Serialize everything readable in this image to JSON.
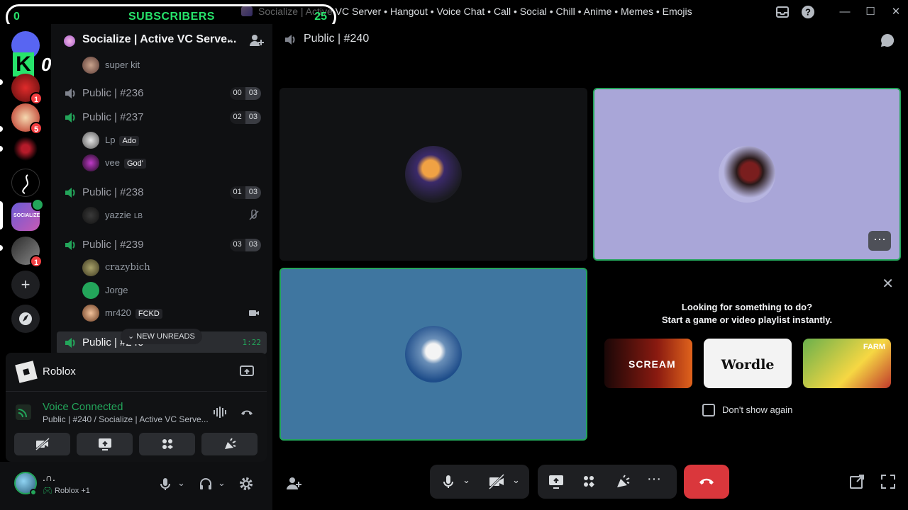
{
  "titlebar": {
    "title": "Socialize | Active VC Server • Hangout • Voice Chat • Call • Social • Chill • Anime • Memes • Emojis",
    "sub_left": "0",
    "sub_label": "SUBSCRIBERS",
    "sub_right": "25"
  },
  "rail": {
    "overlay_zero": "0",
    "badges": [
      "1",
      "5",
      "1"
    ]
  },
  "server": {
    "name": "Socialize | Active VC Serve..."
  },
  "channels": {
    "top_user": "super kit",
    "c236": {
      "name": "Public | #236",
      "a": "00",
      "b": "03"
    },
    "c237": {
      "name": "Public | #237",
      "a": "02",
      "b": "03"
    },
    "c237_users": [
      {
        "name": "Lp",
        "tag": "Ado"
      },
      {
        "name": "vee",
        "tag": "God'"
      }
    ],
    "c238": {
      "name": "Public | #238",
      "a": "01",
      "b": "03"
    },
    "c238_users": [
      {
        "name": "yazzie",
        "tag": "LB"
      }
    ],
    "c239": {
      "name": "Public | #239",
      "a": "03",
      "b": "03"
    },
    "c239_users": [
      {
        "name": "crazybich"
      },
      {
        "name": "Jorge"
      },
      {
        "name": "mr420",
        "tag": "FCKD"
      }
    ],
    "c240": {
      "name": "Public | #240",
      "timer": "1:22"
    },
    "new_unreads": "NEW UNREADS"
  },
  "game_panel": {
    "name": "Roblox"
  },
  "voice_panel": {
    "title": "Voice Connected",
    "subtitle": "Public | #240 / Socialize | Active VC Serve..."
  },
  "user_panel": {
    "name": ".∩.",
    "activity": "Roblox +1"
  },
  "main": {
    "header_title": "Public | #240",
    "activity_line1": "Looking for something to do?",
    "activity_line2": "Start a game or video playlist instantly.",
    "games": [
      "SCREAM",
      "Wordle",
      "FARM"
    ],
    "dont_show": "Don't show again"
  },
  "colors": {
    "accent_green": "#23a55a",
    "leave_red": "#da373c",
    "tile_purple": "#a9a6d8",
    "tile_blue": "#3f76a0",
    "subscriber_green": "#27e36b"
  }
}
